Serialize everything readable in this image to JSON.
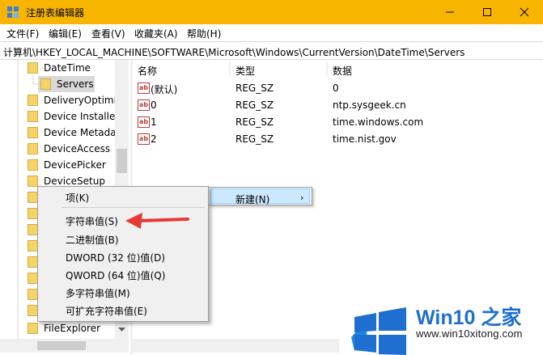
{
  "window": {
    "title": "注册表编辑器"
  },
  "menu": [
    "文件(F)",
    "编辑(E)",
    "查看(V)",
    "收藏夹(A)",
    "帮助(H)"
  ],
  "address": "计算机\\HKEY_LOCAL_MACHINE\\SOFTWARE\\Microsoft\\Windows\\CurrentVersion\\DateTime\\Servers",
  "tree": {
    "items": [
      "DateTime",
      "Servers",
      "DeliveryOptimiz",
      "Device Installer",
      "Device Metada",
      "DeviceAccess",
      "DevicePicker",
      "DeviceSetup",
      "FileExplorer"
    ],
    "selected": "Servers"
  },
  "list": {
    "columns": [
      "名称",
      "类型",
      "数据"
    ],
    "rows": [
      {
        "name": "(默认)",
        "type": "REG_SZ",
        "data": "0"
      },
      {
        "name": "0",
        "type": "REG_SZ",
        "data": "ntp.sysgeek.cn"
      },
      {
        "name": "1",
        "type": "REG_SZ",
        "data": "time.windows.com"
      },
      {
        "name": "2",
        "type": "REG_SZ",
        "data": "time.nist.gov"
      }
    ],
    "icon_text": "ab"
  },
  "context_menu": {
    "new_label": "新建(N)",
    "submenu_arrow": "›",
    "items": [
      "项(K)",
      "字符串值(S)",
      "二进制值(B)",
      "DWORD (32 位)值(D)",
      "QWORD (64 位)值(Q)",
      "多字符串值(M)",
      "可扩充字符串值(E)"
    ]
  },
  "watermark": {
    "brand": "Win10 之家",
    "url": "www.win10xitong.com"
  },
  "colors": {
    "titlebar": "#f7b500",
    "highlight": "#cce8ff",
    "annotation_arrow": "#e53935",
    "brand_blue": "#1e6fd0"
  },
  "icons": [
    "regedit-icon",
    "minimize-icon",
    "maximize-icon",
    "close-icon",
    "folder-icon",
    "reg-string-icon",
    "chevron-right-icon",
    "red-arrow-annotation",
    "windows-logo-icon"
  ]
}
